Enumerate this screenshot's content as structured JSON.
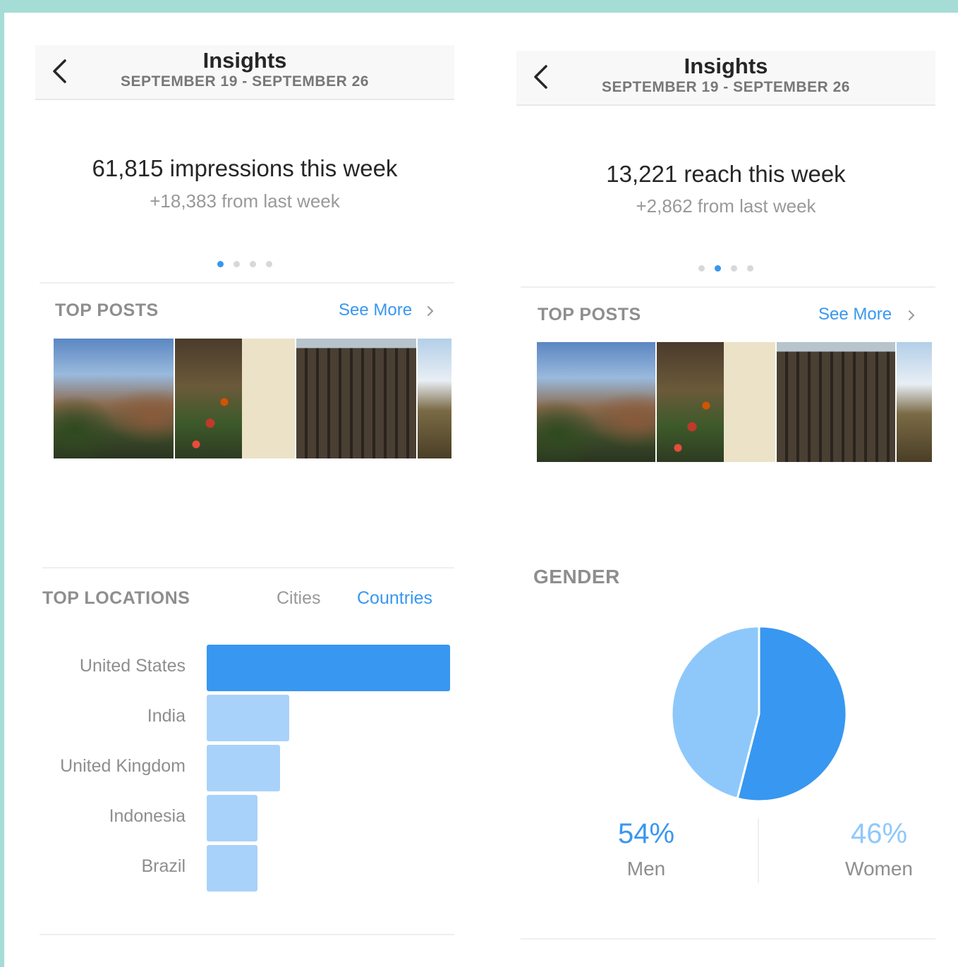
{
  "left": {
    "header": {
      "title": "Insights",
      "subtitle": "SEPTEMBER 19 - SEPTEMBER 26"
    },
    "stat": {
      "main": "61,815 impressions this week",
      "sub": "+18,383 from last week"
    },
    "pager": {
      "count": 4,
      "active_index": 0
    },
    "top_posts": {
      "title": "TOP POSTS",
      "see_more": "See More"
    },
    "locations": {
      "title": "TOP LOCATIONS",
      "tabs": {
        "cities": "Cities",
        "countries": "Countries",
        "selected": "Countries"
      }
    }
  },
  "right": {
    "header": {
      "title": "Insights",
      "subtitle": "SEPTEMBER 19 - SEPTEMBER 26"
    },
    "stat": {
      "main": "13,221 reach this week",
      "sub": "+2,862 from last week"
    },
    "pager": {
      "count": 4,
      "active_index": 1
    },
    "top_posts": {
      "title": "TOP POSTS",
      "see_more": "See More"
    },
    "gender": {
      "title": "GENDER",
      "men": {
        "value": "54%",
        "label": "Men"
      },
      "women": {
        "value": "46%",
        "label": "Women"
      }
    }
  },
  "colors": {
    "accent": "#3897f0",
    "bar_primary": "#3897f0",
    "bar_secondary": "#a9d2fa",
    "pie_men": "#3897f0",
    "pie_women": "#8ec8fb",
    "frame": "#a6dcd6"
  },
  "icons": [
    "back-chevron-icon",
    "chevron-right-icon"
  ],
  "chart_data": [
    {
      "type": "bar",
      "orientation": "horizontal",
      "title": "TOP LOCATIONS",
      "categories": [
        "United States",
        "India",
        "United Kingdom",
        "Indonesia",
        "Brazil"
      ],
      "values": [
        1.0,
        0.34,
        0.3,
        0.21,
        0.21
      ],
      "value_unit": "relative to the largest bar",
      "highlighted_category": "United States"
    },
    {
      "type": "pie",
      "title": "GENDER",
      "categories": [
        "Men",
        "Women"
      ],
      "values": [
        54,
        46
      ],
      "unit": "%"
    }
  ]
}
